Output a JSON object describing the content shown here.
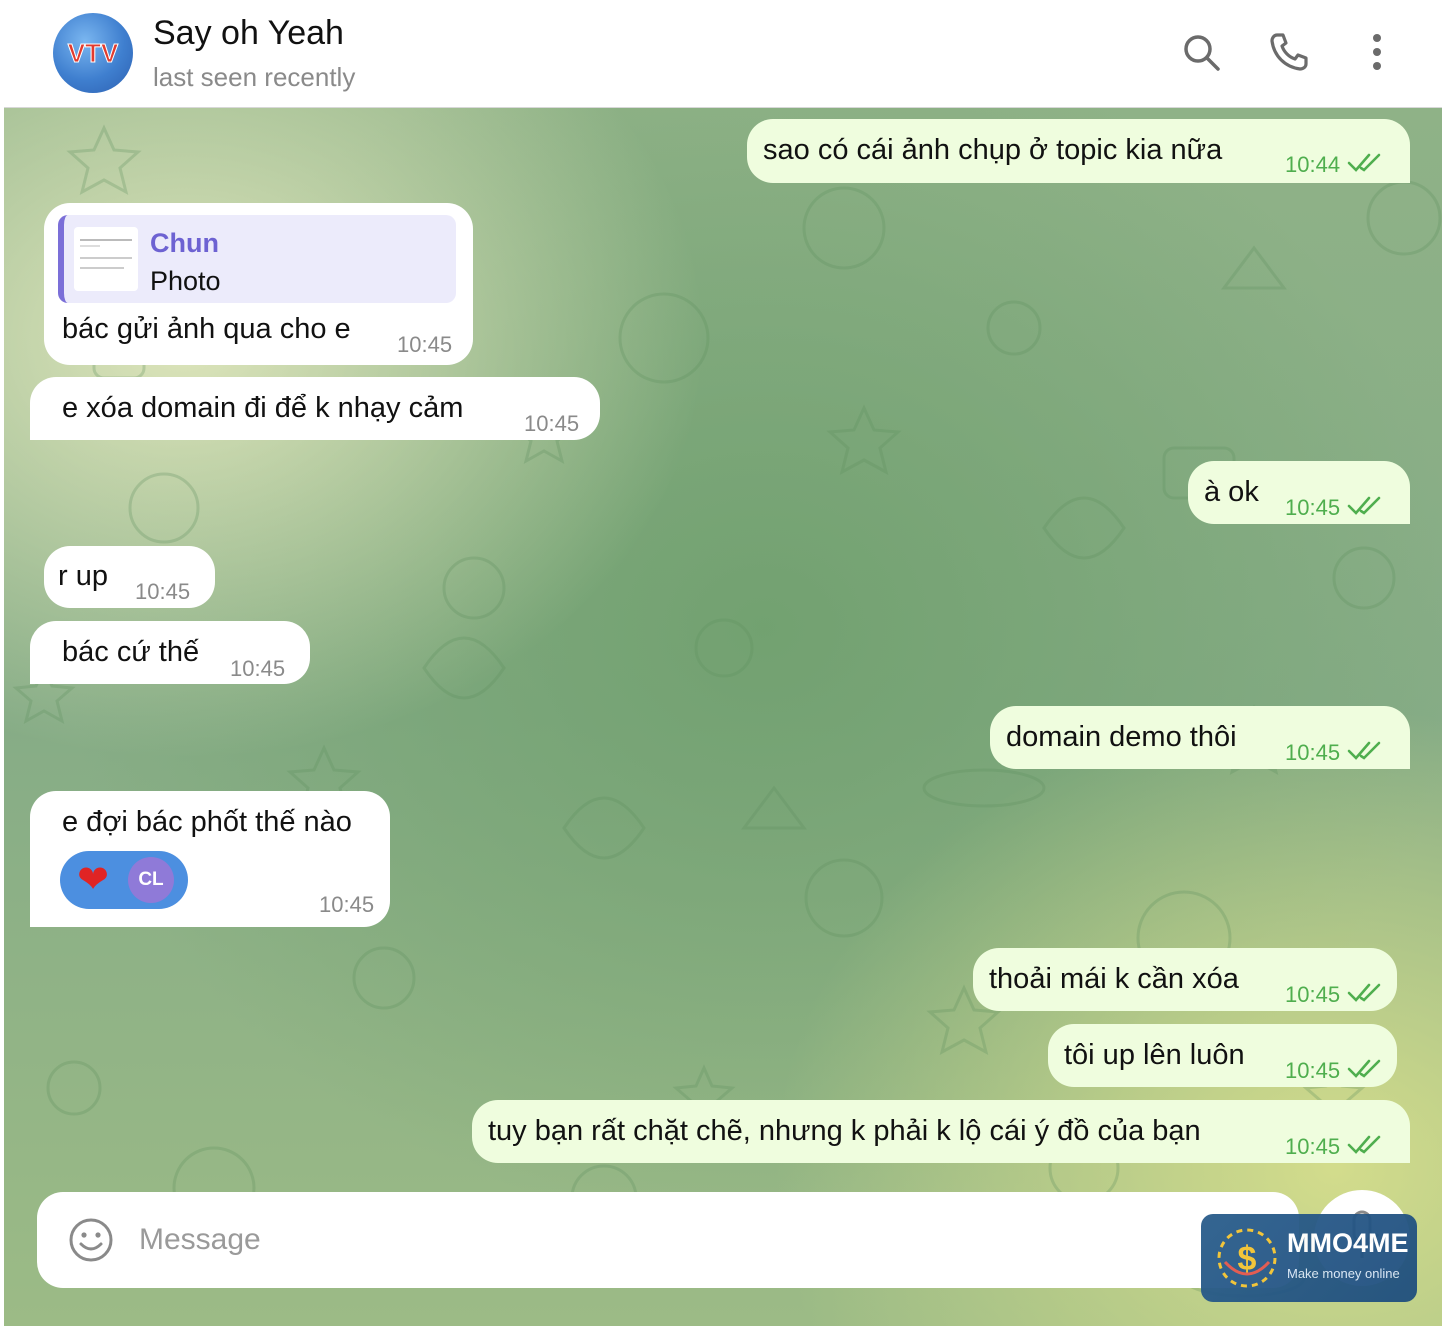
{
  "header": {
    "contact_name": "Say oh Yeah",
    "status": "last seen recently",
    "avatar_logo_text": "VTV"
  },
  "messages": [
    {
      "direction": "out",
      "text": "sao có cái ảnh chụp ở topic kia nữa",
      "time": "10:44",
      "read": true
    },
    {
      "direction": "in",
      "reply_to": {
        "author": "Chun",
        "desc": "Photo"
      },
      "text": "bác gửi ảnh qua cho e",
      "time": "10:45"
    },
    {
      "direction": "in",
      "text": "e xóa domain đi để k nhạy cảm",
      "time": "10:45"
    },
    {
      "direction": "out",
      "text": "à ok",
      "time": "10:45",
      "read": true
    },
    {
      "direction": "in",
      "text": "r up",
      "time": "10:45"
    },
    {
      "direction": "in",
      "text": "bác cứ thế",
      "time": "10:45"
    },
    {
      "direction": "out",
      "text": "domain demo thôi",
      "time": "10:45",
      "read": true
    },
    {
      "direction": "in",
      "text": "e đợi bác phốt thế nào",
      "time": "10:45",
      "reaction": {
        "emoji": "❤",
        "user_initials": "CL"
      }
    },
    {
      "direction": "out",
      "text": "thoải mái k cần xóa",
      "time": "10:45",
      "read": true
    },
    {
      "direction": "out",
      "text": "tôi up lên luôn",
      "time": "10:45",
      "read": true
    },
    {
      "direction": "out",
      "text": "tuy bạn rất chặt chẽ, nhưng k phải k lộ cái ý đồ của bạn",
      "time": "10:45",
      "read": true
    }
  ],
  "composer": {
    "placeholder": "Message",
    "emoji_icon": "smiley-icon",
    "mic_icon": "microphone-icon"
  },
  "watermark": {
    "title": "MMO4ME",
    "subtitle": "Make money online"
  },
  "colors": {
    "outgoing_bubble": "#effdde",
    "incoming_bubble": "#ffffff",
    "read_time": "#4fae4e",
    "reply_accent": "#7b6fd8"
  }
}
